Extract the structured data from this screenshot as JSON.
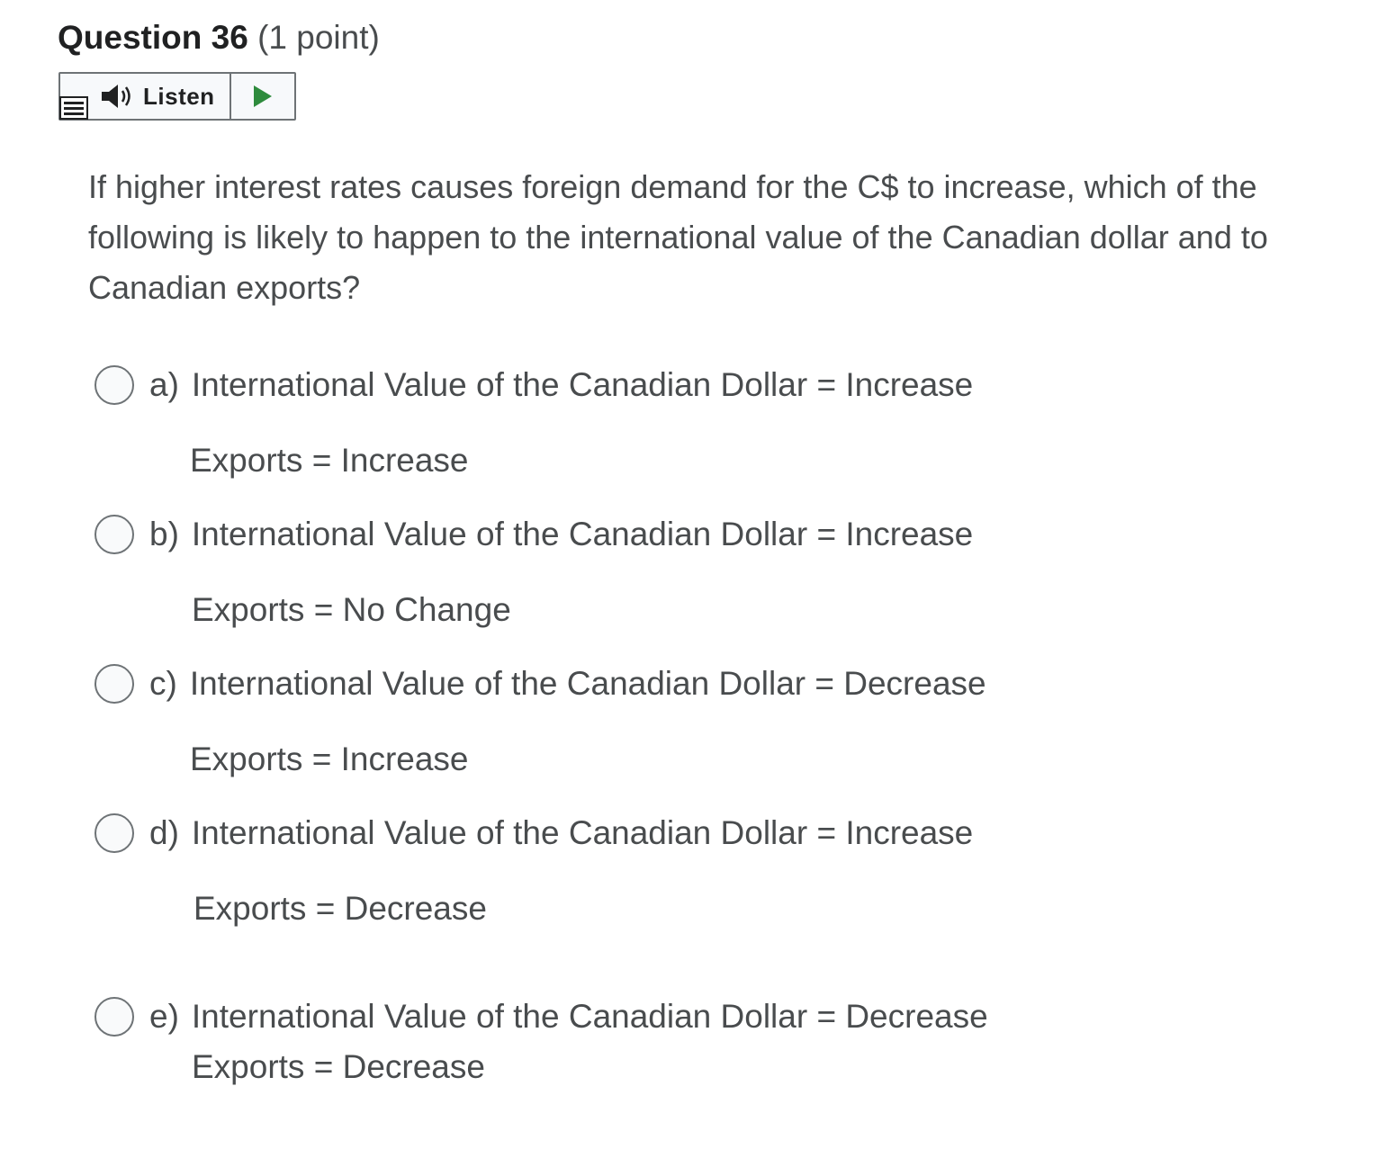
{
  "question": {
    "title": "Question 36",
    "points": "(1 point)",
    "text": "If higher interest rates causes foreign demand for the C$ to increase, which of the following is likely to happen to the international value of the Canadian dollar and to Canadian exports?"
  },
  "listen": {
    "label": "Listen",
    "speaker_icon": "speaker-icon",
    "play_icon": "play-icon",
    "menu_icon": "menu-icon",
    "play_color": "#2e8b3d"
  },
  "options": [
    {
      "letter": "a)",
      "line1": "International Value of the Canadian Dollar = Increase",
      "line2": "Exports = Increase"
    },
    {
      "letter": "b)",
      "line1": "International Value of the Canadian Dollar = Increase",
      "line2": "Exports = No Change"
    },
    {
      "letter": "c)",
      "line1": "International Value of the Canadian Dollar = Decrease",
      "line2": "Exports = Increase"
    },
    {
      "letter": "d)",
      "line1": "International Value of the Canadian Dollar = Increase",
      "line2": "Exports = Decrease"
    },
    {
      "letter": "e)",
      "line1": "International Value of the Canadian Dollar = Decrease",
      "line2": "Exports = Decrease"
    }
  ]
}
